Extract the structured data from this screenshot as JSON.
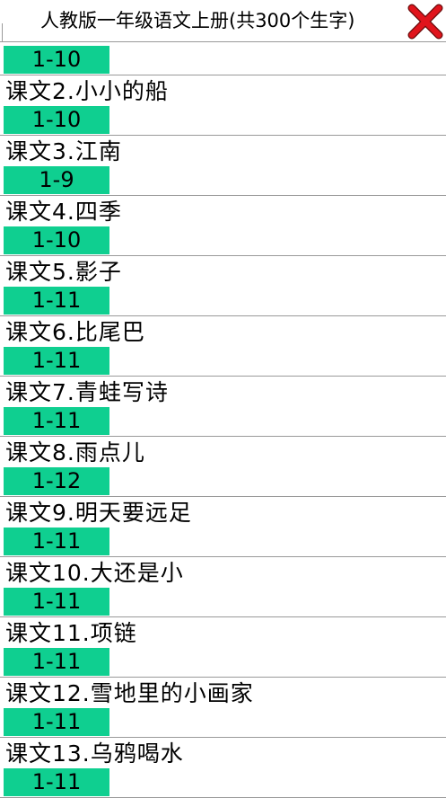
{
  "header": {
    "title": "人教版一年级语文上册(共300个生字)",
    "close_icon": "close-x-icon",
    "close_color": "#e0141c"
  },
  "accent": "#0fcf90",
  "first_range": "1-10",
  "lessons": [
    {
      "title": "课文2.小小的船",
      "range": "1-10"
    },
    {
      "title": "课文3.江南",
      "range": "1-9"
    },
    {
      "title": "课文4.四季",
      "range": "1-10"
    },
    {
      "title": "课文5.影子",
      "range": "1-11"
    },
    {
      "title": "课文6.比尾巴",
      "range": "1-11"
    },
    {
      "title": "课文7.青蛙写诗",
      "range": "1-11"
    },
    {
      "title": "课文8.雨点儿",
      "range": "1-12"
    },
    {
      "title": "课文9.明天要远足",
      "range": "1-11"
    },
    {
      "title": "课文10.大还是小",
      "range": "1-11"
    },
    {
      "title": "课文11.项链",
      "range": "1-11"
    },
    {
      "title": "课文12.雪地里的小画家",
      "range": "1-11"
    },
    {
      "title": "课文13.乌鸦喝水",
      "range": "1-11"
    }
  ]
}
